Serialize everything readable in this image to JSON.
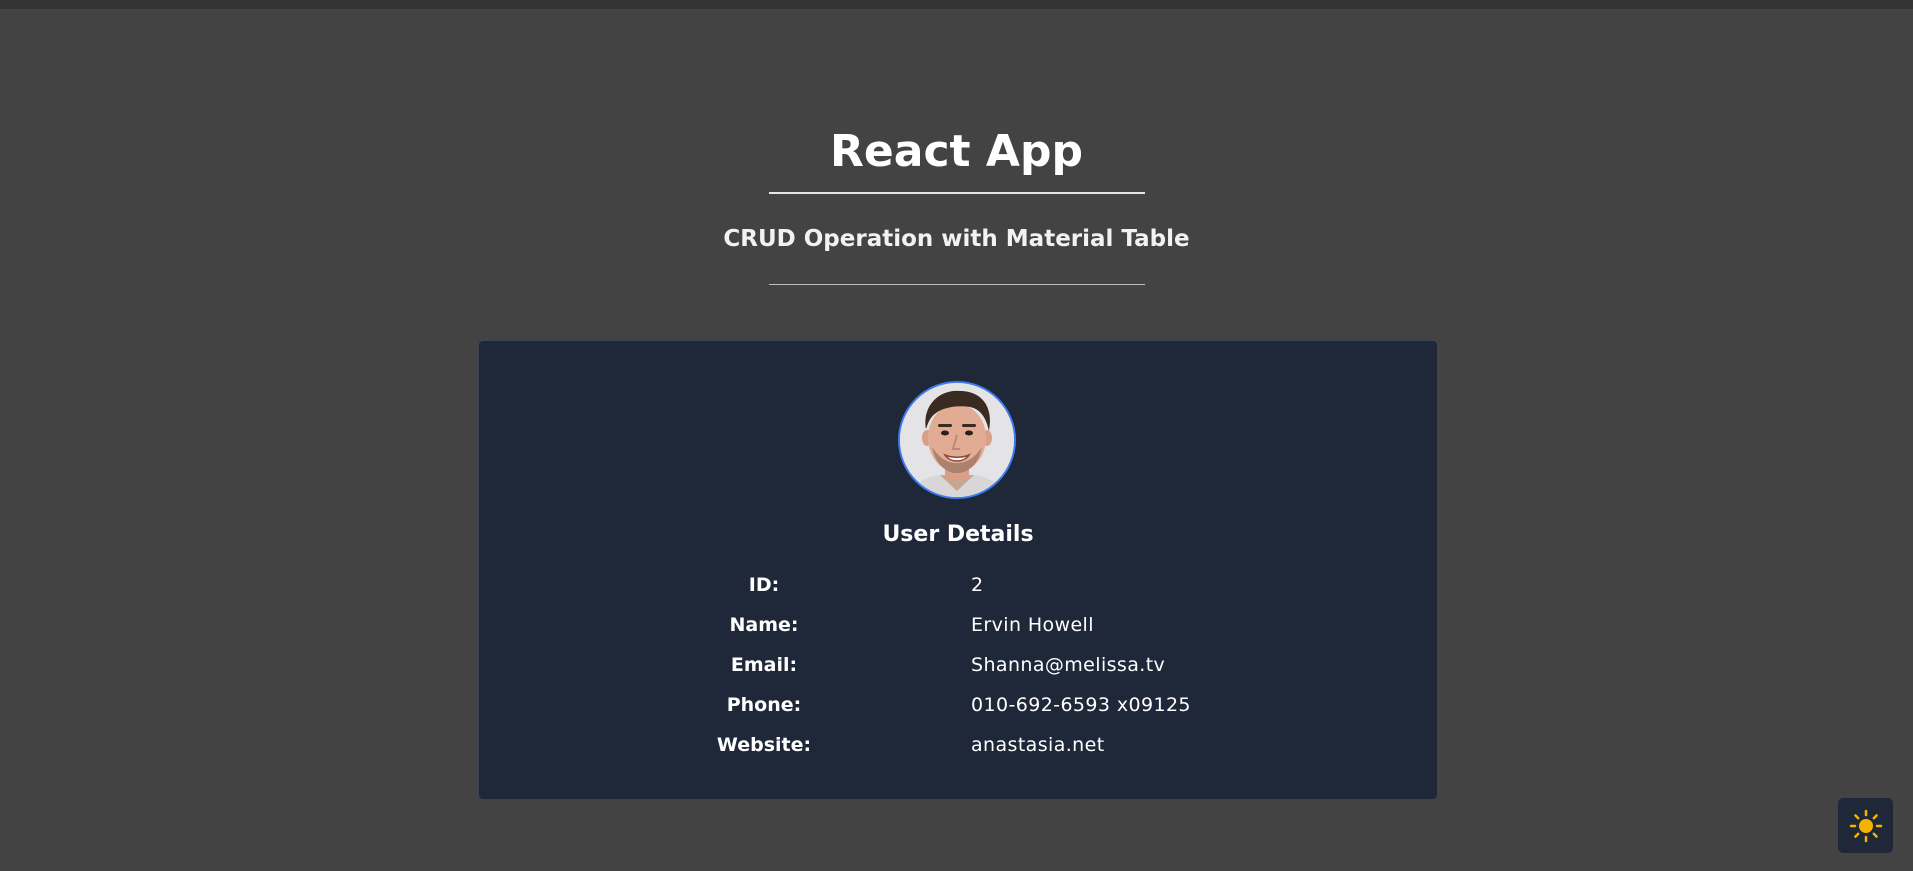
{
  "header": {
    "title": "React App",
    "subtitle": "CRUD Operation with Material Table"
  },
  "card": {
    "title": "User Details",
    "fields": [
      {
        "label": "ID:",
        "value": "2"
      },
      {
        "label": "Name:",
        "value": "Ervin Howell"
      },
      {
        "label": "Email:",
        "value": "Shanna@melissa.tv"
      },
      {
        "label": "Phone:",
        "value": "010-692-6593 x09125"
      },
      {
        "label": "Website:",
        "value": "anastasia.net"
      }
    ]
  },
  "theme_toggle": {
    "icon": "sun-icon",
    "color": "#f5b301"
  },
  "colors": {
    "page_background": "#434343",
    "card_background": "#1f2838",
    "avatar_border": "#3d7bf0"
  }
}
